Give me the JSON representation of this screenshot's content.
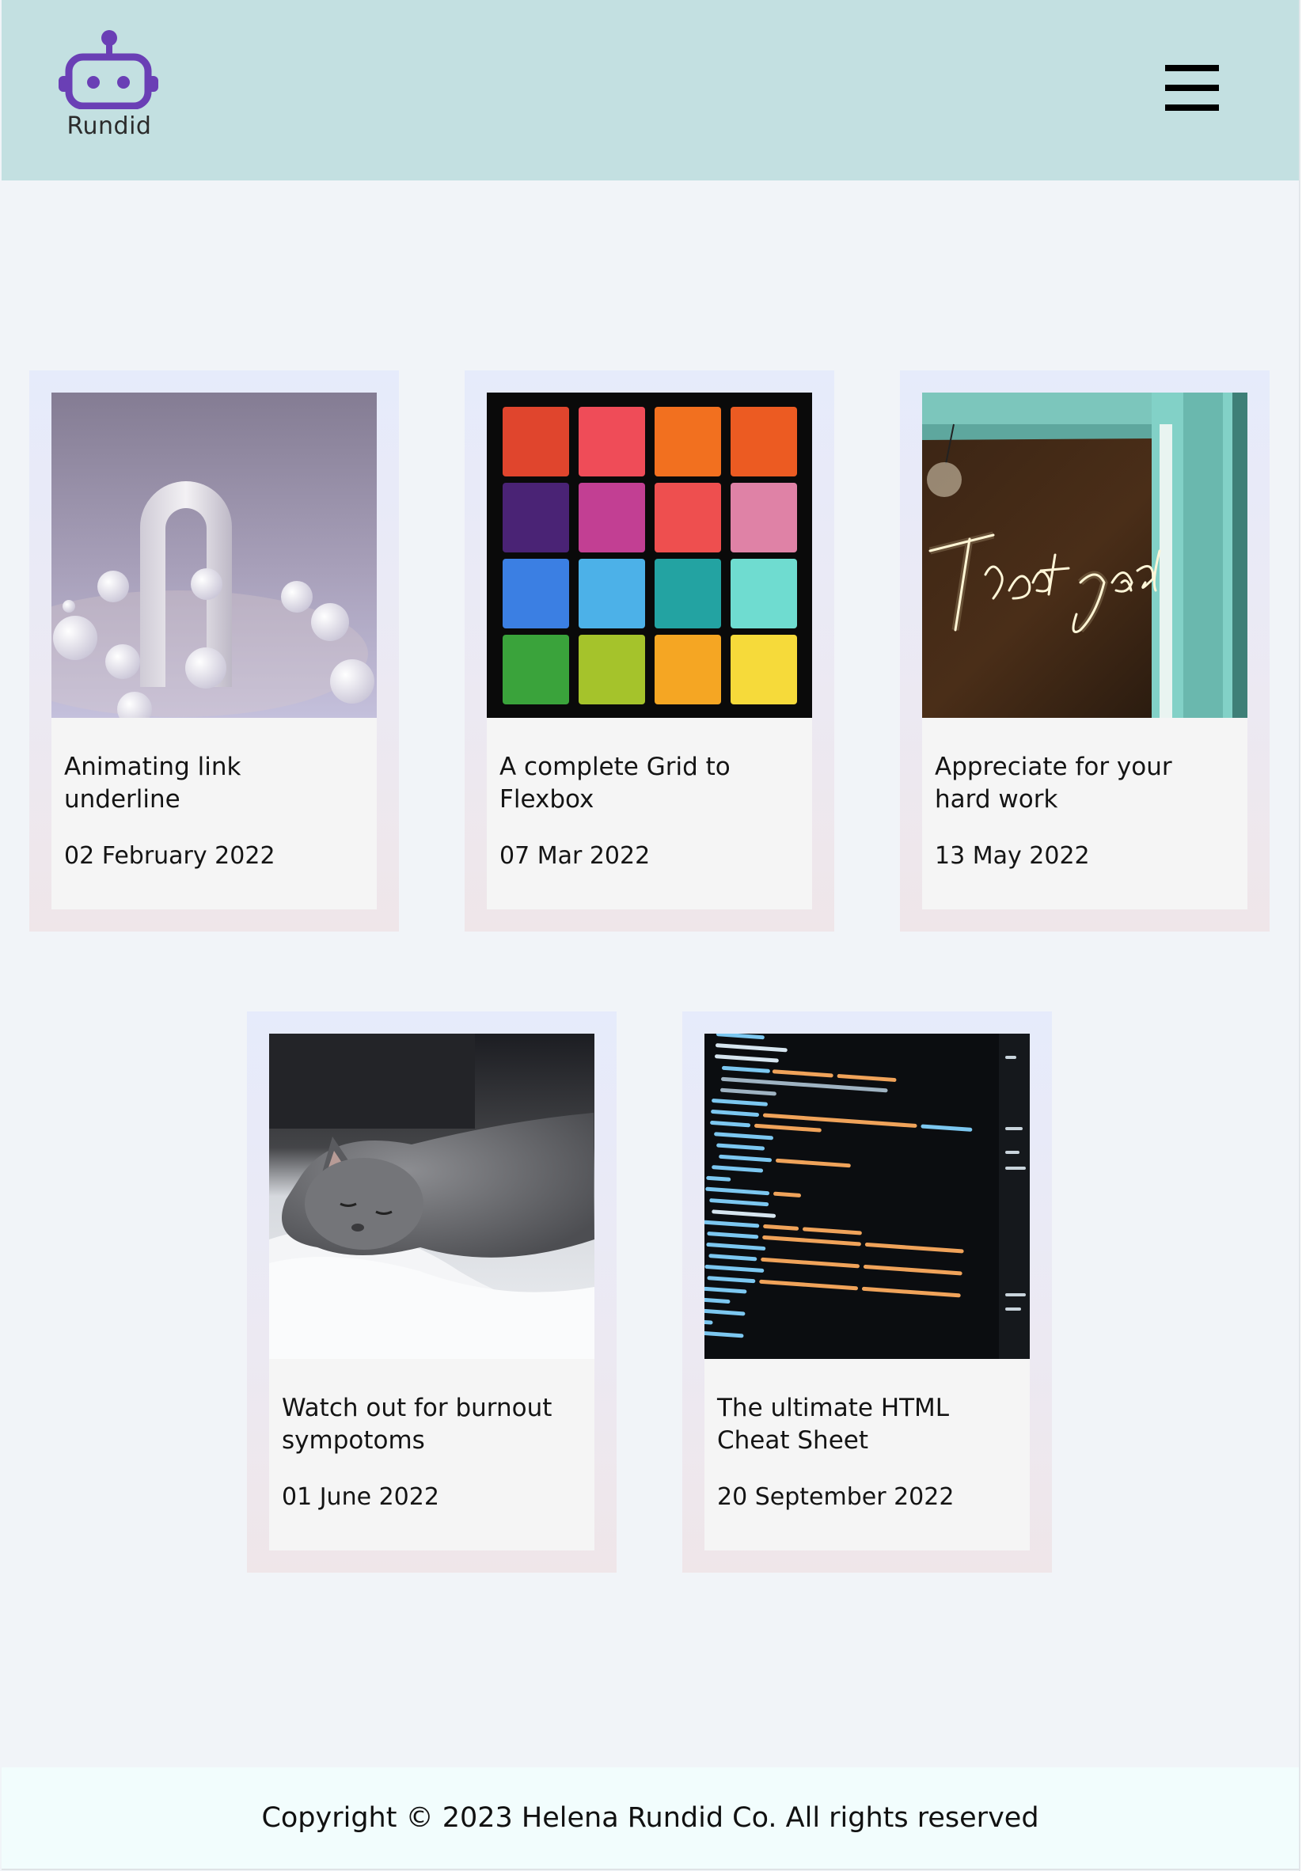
{
  "header": {
    "logo_text": "Rundid",
    "logo_icon": "robot-icon",
    "menu_icon": "hamburger-menu-icon"
  },
  "posts": [
    {
      "title": "Animating link underline",
      "date": "02 February 2022",
      "image": "white-arch-spheres-render"
    },
    {
      "title": "A complete Grid to Flexbox",
      "date": "07 Mar 2022",
      "image": "colorful-eyeshadow-palette"
    },
    {
      "title": "Appreciate for your hard work",
      "date": "13 May 2022",
      "image": "treat-yo-self-neon-sign"
    },
    {
      "title": "Watch out for burnout sympotoms",
      "date": "01 June 2022",
      "image": "sleeping-grey-cat"
    },
    {
      "title": "The ultimate HTML Cheat Sheet",
      "date": "20 September 2022",
      "image": "html-code-screen"
    }
  ],
  "footer": {
    "copyright": "Copyright © 2023 Helena Rundid Co. All rights reserved"
  },
  "colors": {
    "header_bg": "#c3e0e1",
    "page_bg": "#f1f4f8",
    "footer_bg": "#f2fdfd",
    "logo_purple": "#6a3fb5",
    "card_inner_bg": "#f5f5f5"
  }
}
